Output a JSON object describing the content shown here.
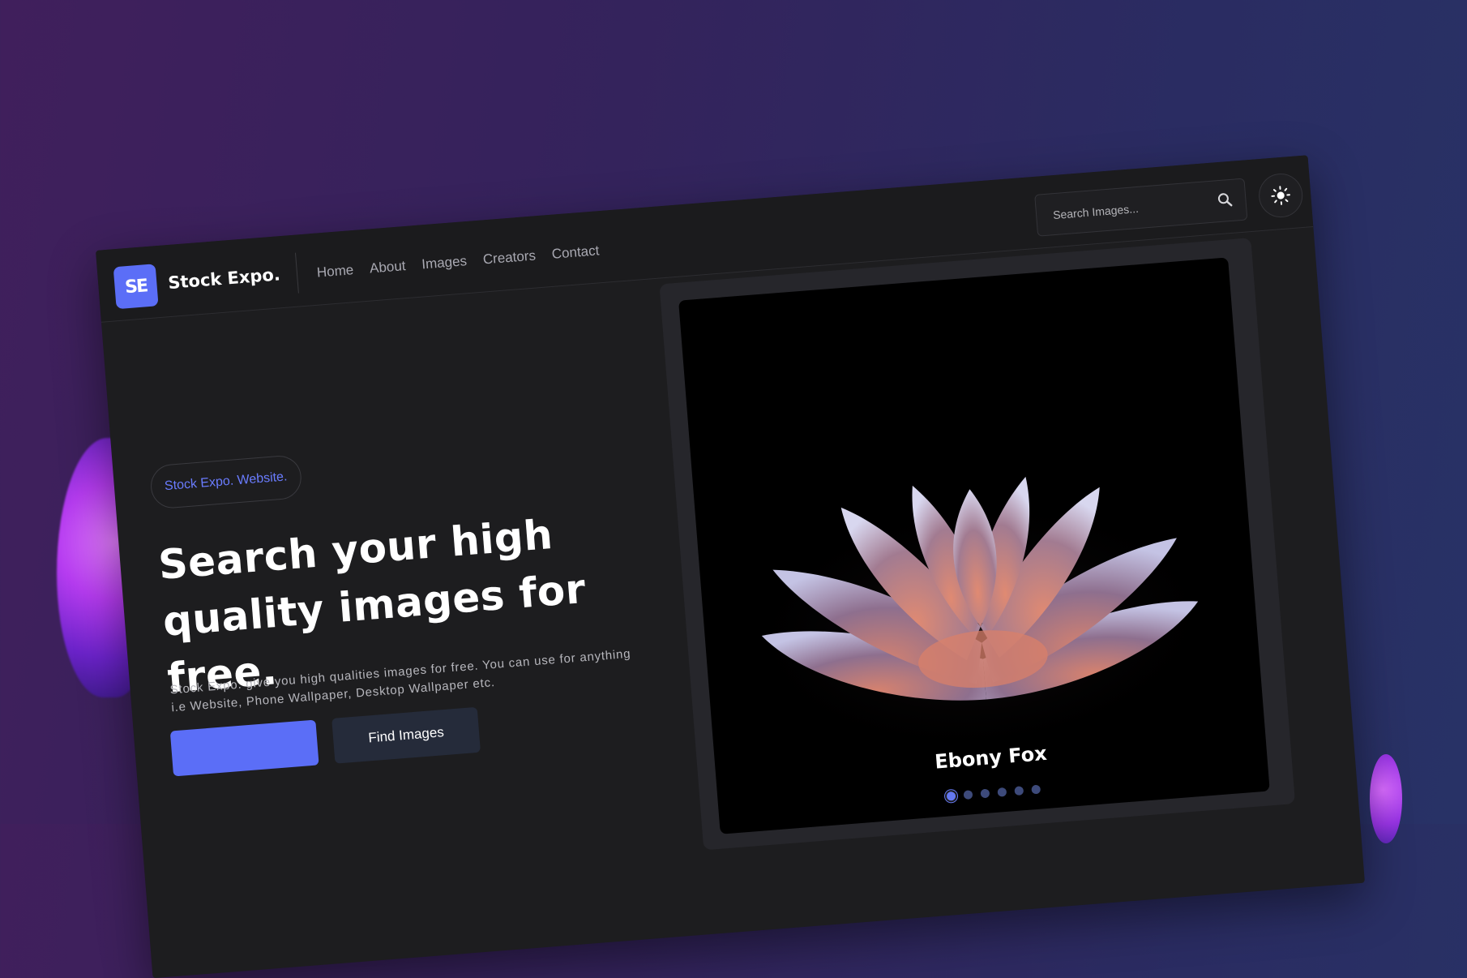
{
  "brand": {
    "logo_text": "SE",
    "name": "Stock Expo."
  },
  "nav": {
    "links": [
      "Home",
      "About",
      "Images",
      "Creators",
      "Contact"
    ]
  },
  "search": {
    "placeholder": "Search Images..."
  },
  "hero": {
    "badge": "Stock Expo. Website.",
    "headline": "Search your high quality images for free.",
    "description": "Stock Expo. give you high qualities images for free. You can use for anything i.e Website, Phone Wallpaper, Desktop Wallpaper etc.",
    "secondary_button": "Find Images"
  },
  "gallery": {
    "caption": "Ebony Fox",
    "slide_count": 6,
    "active_slide": 1
  },
  "colors": {
    "accent": "#5b6ef7",
    "background": "#1d1d1f"
  },
  "icons": {
    "search": "search-icon",
    "theme": "sun-icon"
  }
}
